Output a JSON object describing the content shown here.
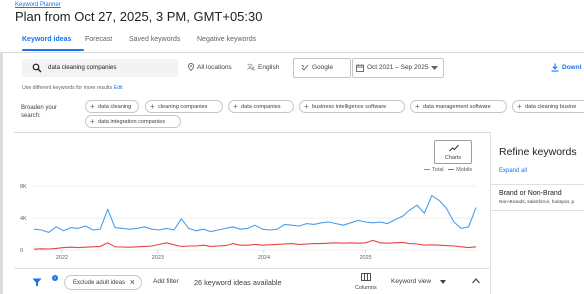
{
  "header": {
    "breadcrumb": "Keyword Planner",
    "title": "Plan from Oct 27, 2025, 3 PM, GMT+05:30"
  },
  "tabs": [
    {
      "label": "Keyword ideas",
      "active": true
    },
    {
      "label": "Forecast",
      "active": false
    },
    {
      "label": "Saved keywords",
      "active": false
    },
    {
      "label": "Negative keywords",
      "active": false
    }
  ],
  "search": {
    "value": "data cleaning companies",
    "icon": "search-icon"
  },
  "filters": {
    "location": "All locations",
    "language": "English",
    "network": "Google",
    "date_range": "Oct 2021 – Sep 2025",
    "download": "Downl"
  },
  "hint": {
    "text": "Use different keywords for more results",
    "edit": "Edit"
  },
  "broaden": {
    "label": "Broaden your search:",
    "chips": [
      "data cleaning",
      "cleaning companies",
      "data companies",
      "business intelligence software",
      "data management software",
      "data cleaning busine",
      "data integration companies"
    ]
  },
  "chart_controls": {
    "charts_button": "Charts",
    "accent": "#1a73e8"
  },
  "chart_data": {
    "type": "line",
    "x_labels": [
      "2022",
      "2023",
      "2024",
      "2025"
    ],
    "ylim": [
      0,
      8000
    ],
    "yticks": [
      "8K",
      "4K",
      "0"
    ],
    "series": [
      {
        "name": "Total",
        "color": "#4a9ee8",
        "values": [
          2600,
          2500,
          2200,
          2900,
          2400,
          2800,
          2700,
          3000,
          2500,
          2600,
          5100,
          2800,
          2700,
          2600,
          2700,
          2900,
          2600,
          2500,
          2700,
          2500,
          3900,
          2700,
          2400,
          2600,
          2300,
          2500,
          2700,
          2900,
          2600,
          2700,
          3100,
          2600,
          2500,
          2600,
          3200,
          3100,
          3000,
          3300,
          3200,
          3400,
          3500,
          3300,
          3100,
          3400,
          3700,
          3500,
          3400,
          3500,
          3300,
          3800,
          4200,
          5000,
          5600,
          4600,
          6800,
          6200,
          5200,
          3500,
          2700,
          2900,
          5300
        ]
      },
      {
        "name": "Mobile",
        "color": "#e8453c",
        "values": [
          100,
          150,
          120,
          200,
          300,
          350,
          300,
          350,
          400,
          450,
          900,
          400,
          380,
          350,
          400,
          450,
          500,
          700,
          900,
          650,
          450,
          500,
          500,
          600,
          450,
          500,
          550,
          800,
          600,
          600,
          700,
          600,
          650,
          700,
          750,
          800,
          700,
          750,
          800,
          800,
          850,
          900,
          850,
          900,
          850,
          900,
          1200,
          900,
          850,
          900,
          950,
          800,
          750,
          600,
          650,
          600,
          550,
          500,
          400,
          300,
          400
        ]
      }
    ],
    "legend_position": "top-right",
    "grid": true
  },
  "bottom_bar": {
    "filter_badge": "1",
    "exclude_chip": "Exclude adult ideas",
    "add_filter": "Add filter",
    "count": "26 keyword ideas available",
    "columns": "Columns",
    "view": "Keyword view"
  },
  "refine": {
    "title": "Refine keywords",
    "expand_all": "Expand all",
    "brand_title": "Brand or Non-Brand",
    "brand_sub": "Non-Brands, salesforce, hubspot, p"
  }
}
